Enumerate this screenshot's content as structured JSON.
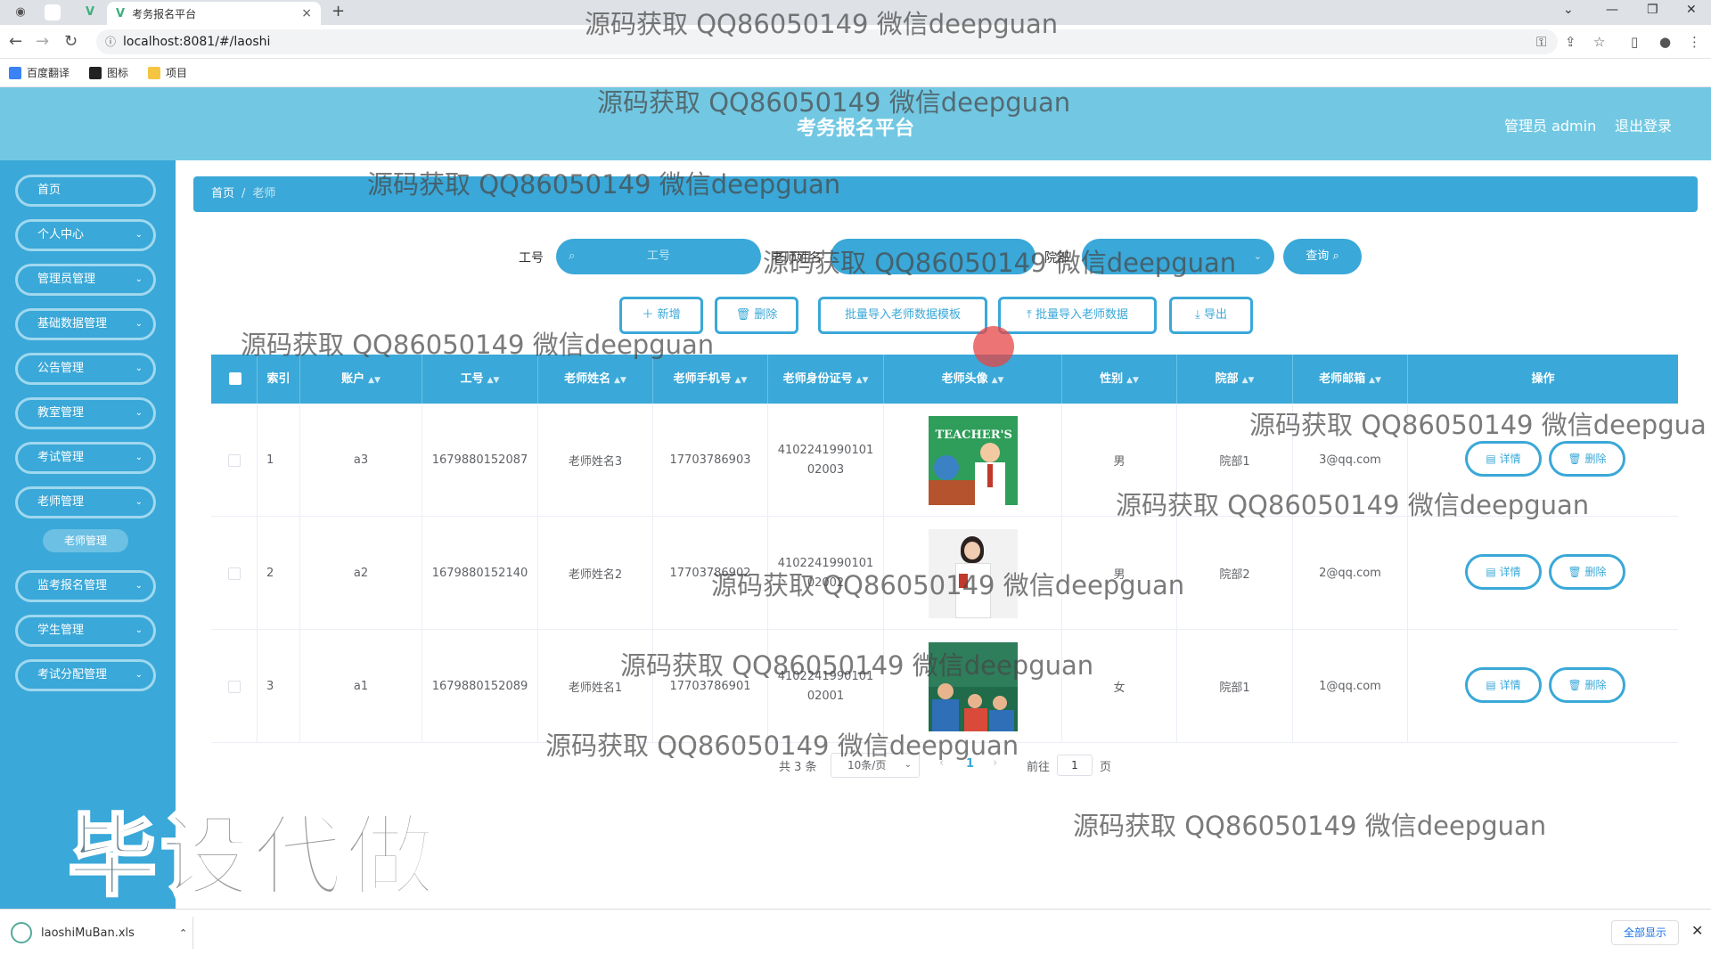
{
  "browser": {
    "tab_title": "考务报名平台",
    "url": "localhost:8081/#/laoshi",
    "bookmarks": [
      "百度翻译",
      "图标",
      "项目"
    ]
  },
  "header": {
    "title": "考务报名平台",
    "user": "管理员 admin",
    "logout": "退出登录"
  },
  "sidebar": {
    "items": [
      "首页",
      "个人中心",
      "管理员管理",
      "基础数据管理",
      "公告管理",
      "教室管理",
      "考试管理",
      "老师管理",
      "监考报名管理",
      "学生管理",
      "考试分配管理"
    ],
    "sub_item": "老师管理"
  },
  "breadcrumb": {
    "home": "首页",
    "current": "老师"
  },
  "search": {
    "label_gonghao": "工号",
    "placeholder_gonghao": "工号",
    "label_name": "老师姓名",
    "label_yuanbu": "院部",
    "button": "查询"
  },
  "actions": {
    "add": "新增",
    "delete": "删除",
    "template": "批量导入老师数据模板",
    "import": "批量导入老师数据",
    "export": "导出"
  },
  "table": {
    "columns": [
      "索引",
      "账户",
      "工号",
      "老师姓名",
      "老师手机号",
      "老师身份证号",
      "老师头像",
      "性别",
      "院部",
      "老师邮箱",
      "操作"
    ],
    "rows": [
      {
        "index": "1",
        "account": "a3",
        "gonghao": "1679880152087",
        "name": "老师姓名3",
        "phone": "17703786903",
        "idcard": "410224199010102003",
        "gender": "男",
        "yuanbu": "院部1",
        "email": "3@qq.com"
      },
      {
        "index": "2",
        "account": "a2",
        "gonghao": "1679880152140",
        "name": "老师姓名2",
        "phone": "17703786902",
        "idcard": "410224199010102002",
        "gender": "男",
        "yuanbu": "院部2",
        "email": "2@qq.com"
      },
      {
        "index": "3",
        "account": "a1",
        "gonghao": "1679880152089",
        "name": "老师姓名1",
        "phone": "17703786901",
        "idcard": "410224199010102001",
        "gender": "女",
        "yuanbu": "院部1",
        "email": "1@qq.com"
      }
    ],
    "detail_btn": "详情",
    "delete_btn": "删除"
  },
  "pagination": {
    "total": "共 3 条",
    "page_size": "10条/页",
    "current": "1",
    "goto_label": "前往",
    "goto_value": "1",
    "page_suffix": "页"
  },
  "download": {
    "file": "laoshiMuBan.xls",
    "show_all": "全部显示"
  },
  "watermark": {
    "text": "源码获取 QQ86050149 微信deepguan",
    "text_cut": "源码获取 QQ86050149 微信deepgua",
    "big": "毕设代做"
  },
  "colors": {
    "primary": "#3aa8d8",
    "header": "#72c8e3"
  }
}
